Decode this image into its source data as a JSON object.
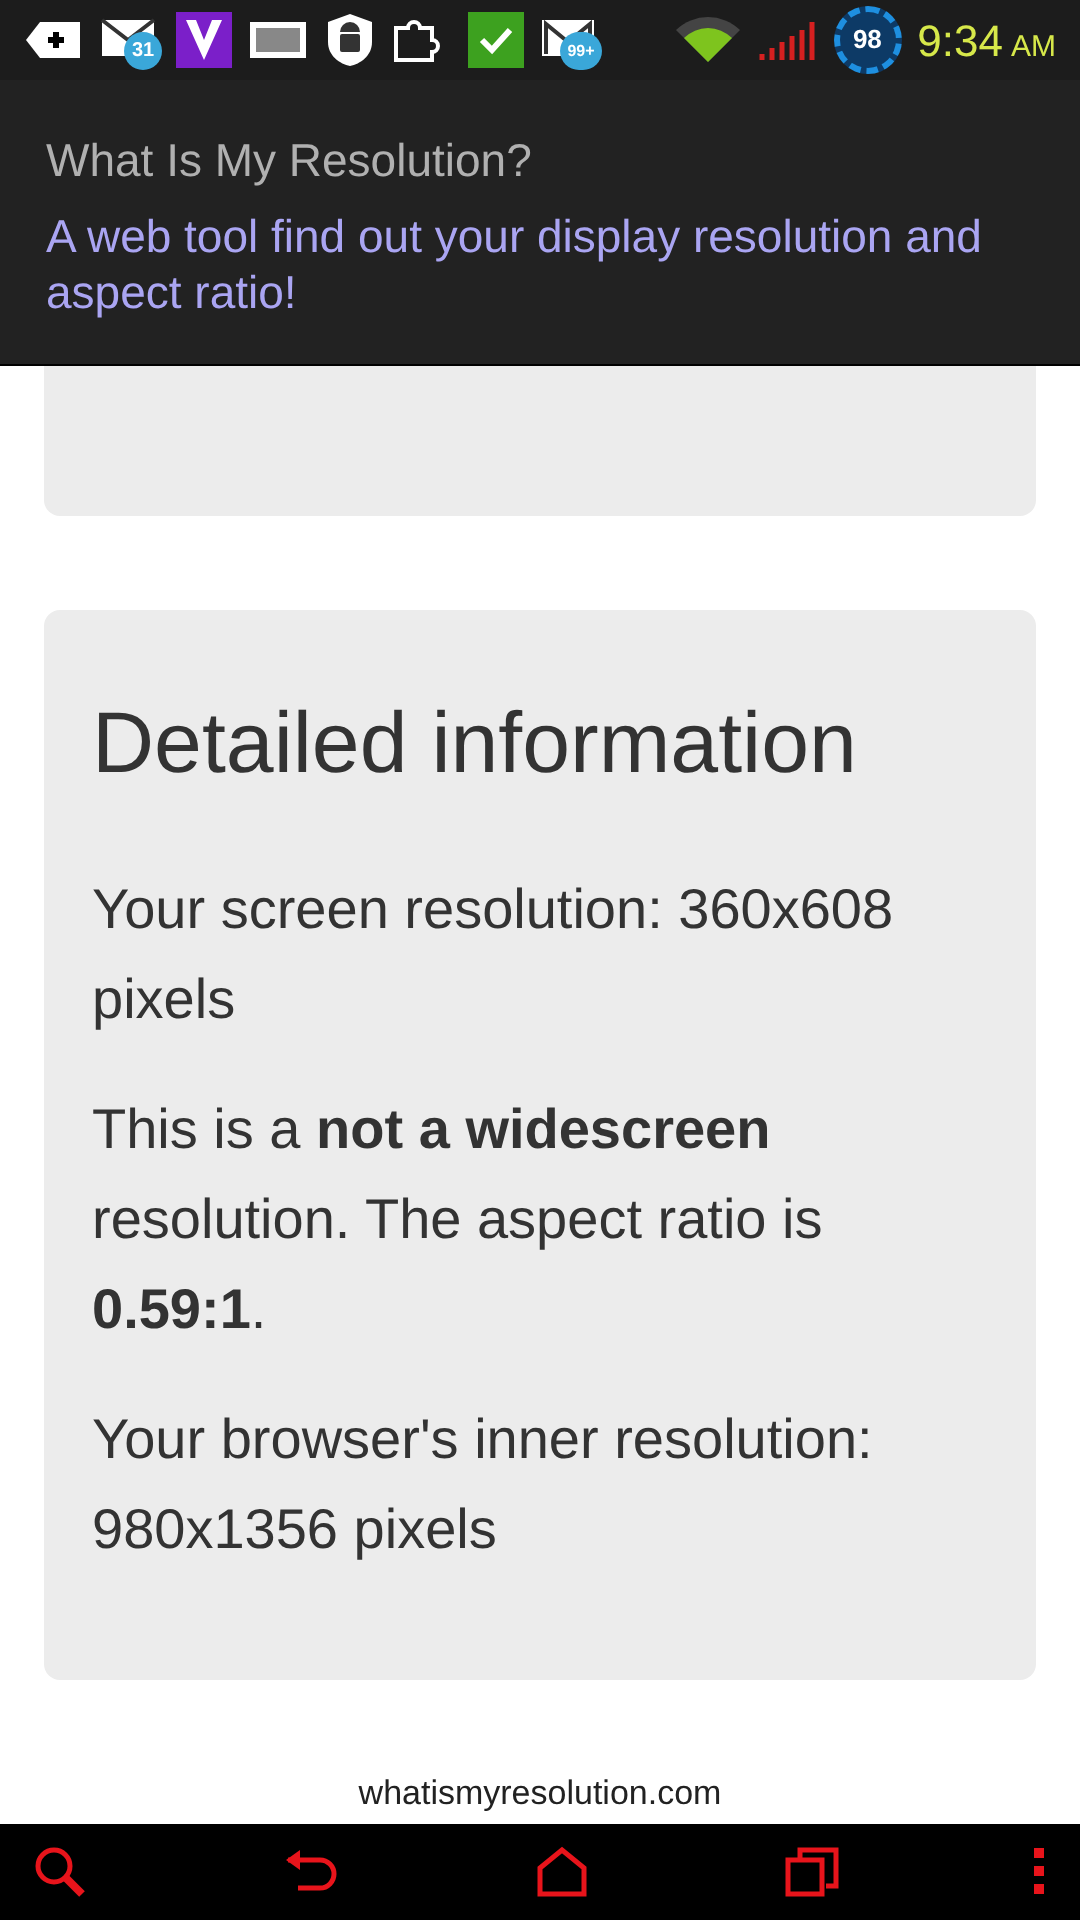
{
  "status_bar": {
    "email_badge": "31",
    "mail_badge": "99+",
    "battery": "98",
    "time": "9:34",
    "ampm": "AM"
  },
  "app_header": {
    "title": "What Is My Resolution?",
    "subtitle": "A web tool find out your display resolution and aspect ratio!"
  },
  "card": {
    "heading": "Detailed information",
    "paragraphs": [
      "Your screen resolution: 360x608 pixels",
      "This is a **not a widescreen** resolution. The aspect ratio is **0.59:1**.",
      "Your browser's inner resolution: 980x1356 pixels"
    ]
  },
  "footer": "whatismyresolution.com"
}
